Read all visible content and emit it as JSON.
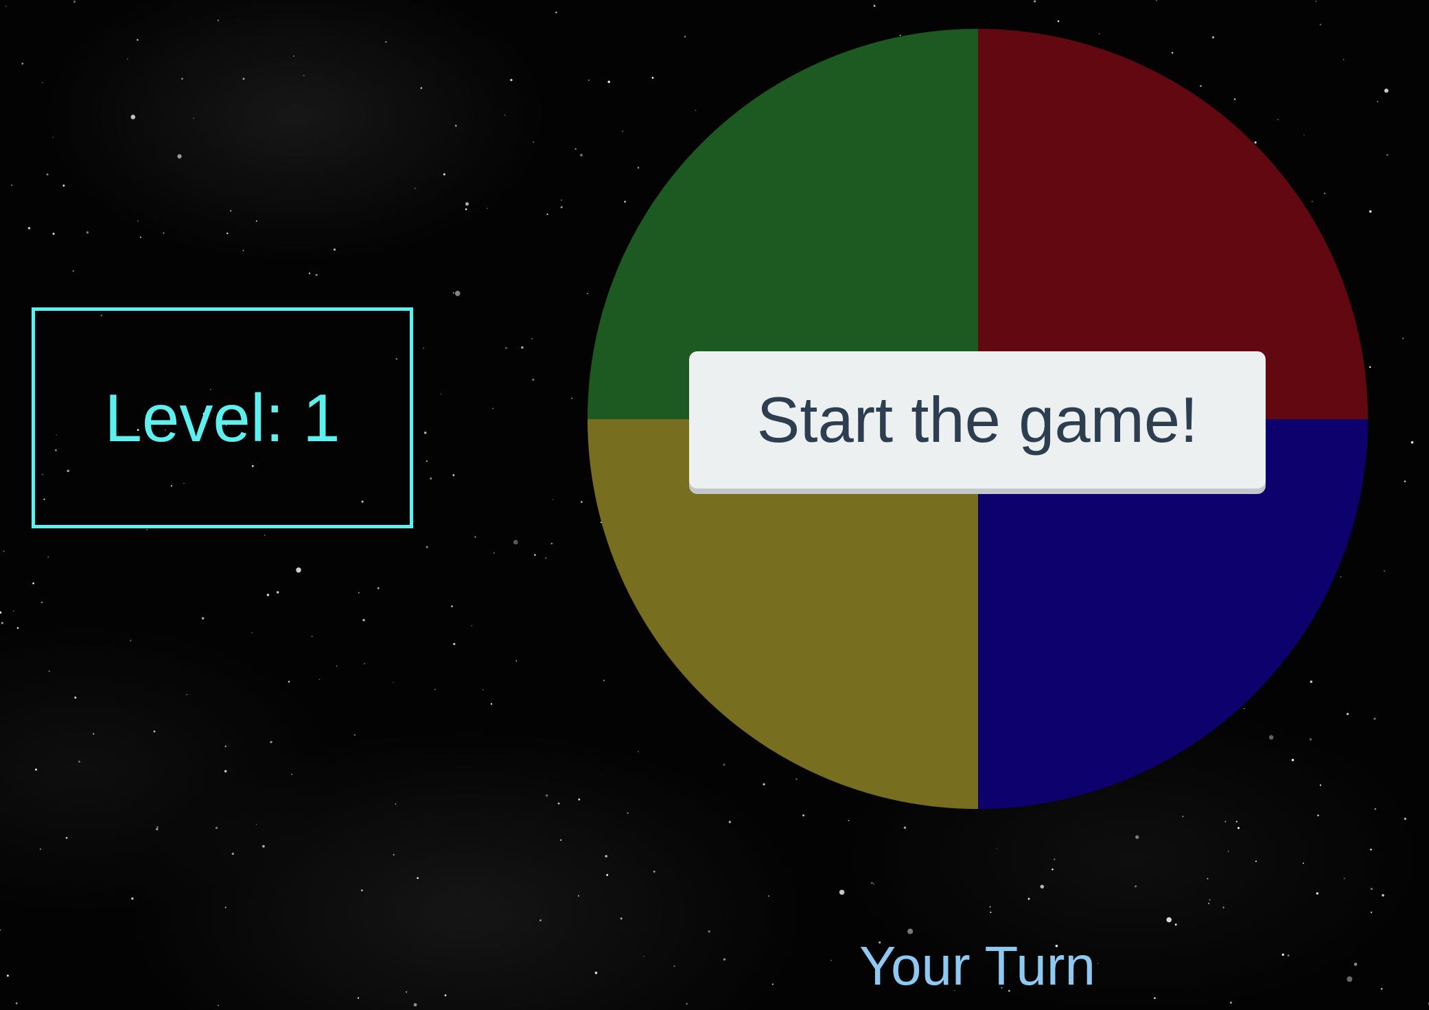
{
  "level": {
    "text": "Level: 1",
    "color": "#5ef0ef"
  },
  "board": {
    "pads": [
      {
        "name": "green",
        "color": "#1d5a22"
      },
      {
        "name": "red",
        "color": "#620810"
      },
      {
        "name": "yellow",
        "color": "#776e20"
      },
      {
        "name": "blue",
        "color": "#0d016e"
      }
    ]
  },
  "start_button": {
    "label": "Start the game!"
  },
  "turn": {
    "label": "Your Turn",
    "color": "#8ec9f2"
  }
}
